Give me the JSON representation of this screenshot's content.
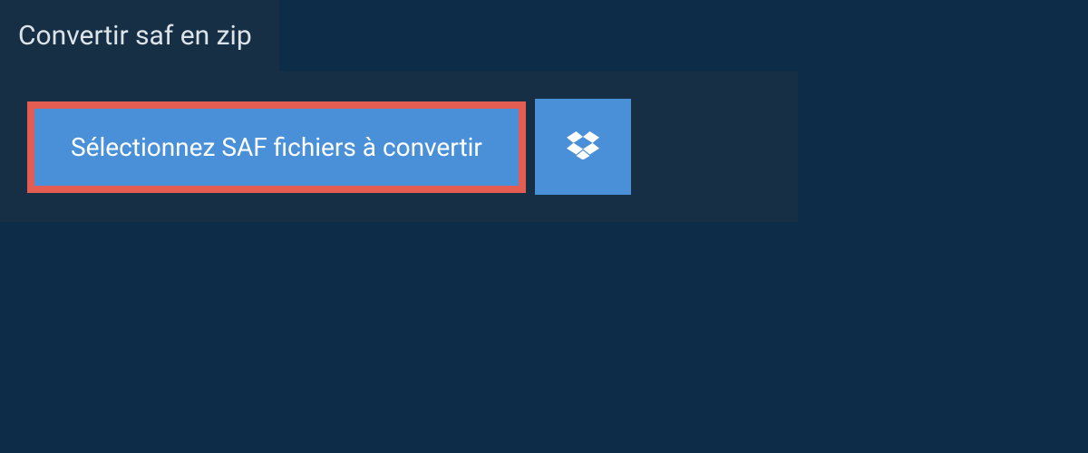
{
  "header": {
    "title": "Convertir saf en zip"
  },
  "buttons": {
    "select_files_label": "Sélectionnez SAF fichiers à convertir",
    "dropbox_label": "Dropbox"
  },
  "colors": {
    "background": "#0d2c47",
    "panel": "#162f45",
    "button_bg": "#4a90d9",
    "highlight_border": "#e35d53",
    "text_light": "#dce4ea",
    "text_white": "#ffffff"
  }
}
